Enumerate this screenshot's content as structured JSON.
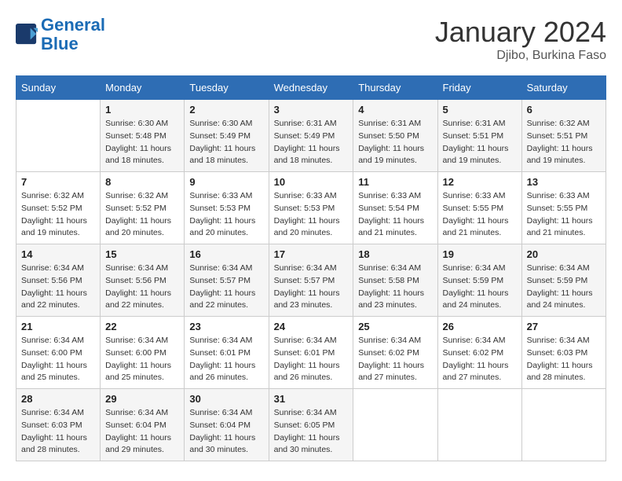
{
  "logo": {
    "line1": "General",
    "line2": "Blue"
  },
  "title": "January 2024",
  "location": "Djibo, Burkina Faso",
  "weekdays": [
    "Sunday",
    "Monday",
    "Tuesday",
    "Wednesday",
    "Thursday",
    "Friday",
    "Saturday"
  ],
  "weeks": [
    [
      {
        "day": "",
        "sunrise": "",
        "sunset": "",
        "daylight": ""
      },
      {
        "day": "1",
        "sunrise": "Sunrise: 6:30 AM",
        "sunset": "Sunset: 5:48 PM",
        "daylight": "Daylight: 11 hours and 18 minutes."
      },
      {
        "day": "2",
        "sunrise": "Sunrise: 6:30 AM",
        "sunset": "Sunset: 5:49 PM",
        "daylight": "Daylight: 11 hours and 18 minutes."
      },
      {
        "day": "3",
        "sunrise": "Sunrise: 6:31 AM",
        "sunset": "Sunset: 5:49 PM",
        "daylight": "Daylight: 11 hours and 18 minutes."
      },
      {
        "day": "4",
        "sunrise": "Sunrise: 6:31 AM",
        "sunset": "Sunset: 5:50 PM",
        "daylight": "Daylight: 11 hours and 19 minutes."
      },
      {
        "day": "5",
        "sunrise": "Sunrise: 6:31 AM",
        "sunset": "Sunset: 5:51 PM",
        "daylight": "Daylight: 11 hours and 19 minutes."
      },
      {
        "day": "6",
        "sunrise": "Sunrise: 6:32 AM",
        "sunset": "Sunset: 5:51 PM",
        "daylight": "Daylight: 11 hours and 19 minutes."
      }
    ],
    [
      {
        "day": "7",
        "sunrise": "Sunrise: 6:32 AM",
        "sunset": "Sunset: 5:52 PM",
        "daylight": "Daylight: 11 hours and 19 minutes."
      },
      {
        "day": "8",
        "sunrise": "Sunrise: 6:32 AM",
        "sunset": "Sunset: 5:52 PM",
        "daylight": "Daylight: 11 hours and 20 minutes."
      },
      {
        "day": "9",
        "sunrise": "Sunrise: 6:33 AM",
        "sunset": "Sunset: 5:53 PM",
        "daylight": "Daylight: 11 hours and 20 minutes."
      },
      {
        "day": "10",
        "sunrise": "Sunrise: 6:33 AM",
        "sunset": "Sunset: 5:53 PM",
        "daylight": "Daylight: 11 hours and 20 minutes."
      },
      {
        "day": "11",
        "sunrise": "Sunrise: 6:33 AM",
        "sunset": "Sunset: 5:54 PM",
        "daylight": "Daylight: 11 hours and 21 minutes."
      },
      {
        "day": "12",
        "sunrise": "Sunrise: 6:33 AM",
        "sunset": "Sunset: 5:55 PM",
        "daylight": "Daylight: 11 hours and 21 minutes."
      },
      {
        "day": "13",
        "sunrise": "Sunrise: 6:33 AM",
        "sunset": "Sunset: 5:55 PM",
        "daylight": "Daylight: 11 hours and 21 minutes."
      }
    ],
    [
      {
        "day": "14",
        "sunrise": "Sunrise: 6:34 AM",
        "sunset": "Sunset: 5:56 PM",
        "daylight": "Daylight: 11 hours and 22 minutes."
      },
      {
        "day": "15",
        "sunrise": "Sunrise: 6:34 AM",
        "sunset": "Sunset: 5:56 PM",
        "daylight": "Daylight: 11 hours and 22 minutes."
      },
      {
        "day": "16",
        "sunrise": "Sunrise: 6:34 AM",
        "sunset": "Sunset: 5:57 PM",
        "daylight": "Daylight: 11 hours and 22 minutes."
      },
      {
        "day": "17",
        "sunrise": "Sunrise: 6:34 AM",
        "sunset": "Sunset: 5:57 PM",
        "daylight": "Daylight: 11 hours and 23 minutes."
      },
      {
        "day": "18",
        "sunrise": "Sunrise: 6:34 AM",
        "sunset": "Sunset: 5:58 PM",
        "daylight": "Daylight: 11 hours and 23 minutes."
      },
      {
        "day": "19",
        "sunrise": "Sunrise: 6:34 AM",
        "sunset": "Sunset: 5:59 PM",
        "daylight": "Daylight: 11 hours and 24 minutes."
      },
      {
        "day": "20",
        "sunrise": "Sunrise: 6:34 AM",
        "sunset": "Sunset: 5:59 PM",
        "daylight": "Daylight: 11 hours and 24 minutes."
      }
    ],
    [
      {
        "day": "21",
        "sunrise": "Sunrise: 6:34 AM",
        "sunset": "Sunset: 6:00 PM",
        "daylight": "Daylight: 11 hours and 25 minutes."
      },
      {
        "day": "22",
        "sunrise": "Sunrise: 6:34 AM",
        "sunset": "Sunset: 6:00 PM",
        "daylight": "Daylight: 11 hours and 25 minutes."
      },
      {
        "day": "23",
        "sunrise": "Sunrise: 6:34 AM",
        "sunset": "Sunset: 6:01 PM",
        "daylight": "Daylight: 11 hours and 26 minutes."
      },
      {
        "day": "24",
        "sunrise": "Sunrise: 6:34 AM",
        "sunset": "Sunset: 6:01 PM",
        "daylight": "Daylight: 11 hours and 26 minutes."
      },
      {
        "day": "25",
        "sunrise": "Sunrise: 6:34 AM",
        "sunset": "Sunset: 6:02 PM",
        "daylight": "Daylight: 11 hours and 27 minutes."
      },
      {
        "day": "26",
        "sunrise": "Sunrise: 6:34 AM",
        "sunset": "Sunset: 6:02 PM",
        "daylight": "Daylight: 11 hours and 27 minutes."
      },
      {
        "day": "27",
        "sunrise": "Sunrise: 6:34 AM",
        "sunset": "Sunset: 6:03 PM",
        "daylight": "Daylight: 11 hours and 28 minutes."
      }
    ],
    [
      {
        "day": "28",
        "sunrise": "Sunrise: 6:34 AM",
        "sunset": "Sunset: 6:03 PM",
        "daylight": "Daylight: 11 hours and 28 minutes."
      },
      {
        "day": "29",
        "sunrise": "Sunrise: 6:34 AM",
        "sunset": "Sunset: 6:04 PM",
        "daylight": "Daylight: 11 hours and 29 minutes."
      },
      {
        "day": "30",
        "sunrise": "Sunrise: 6:34 AM",
        "sunset": "Sunset: 6:04 PM",
        "daylight": "Daylight: 11 hours and 30 minutes."
      },
      {
        "day": "31",
        "sunrise": "Sunrise: 6:34 AM",
        "sunset": "Sunset: 6:05 PM",
        "daylight": "Daylight: 11 hours and 30 minutes."
      },
      {
        "day": "",
        "sunrise": "",
        "sunset": "",
        "daylight": ""
      },
      {
        "day": "",
        "sunrise": "",
        "sunset": "",
        "daylight": ""
      },
      {
        "day": "",
        "sunrise": "",
        "sunset": "",
        "daylight": ""
      }
    ]
  ]
}
